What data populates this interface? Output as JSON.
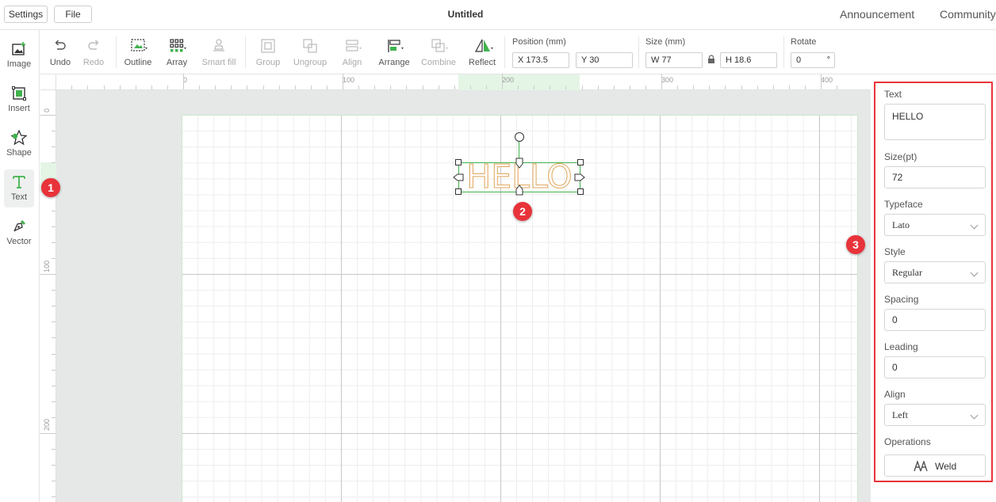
{
  "topbar": {
    "settings_label": "Settings",
    "file_label": "File",
    "title": "Untitled",
    "announcement_label": "Announcement",
    "community_label": "Community"
  },
  "tools": {
    "image": "Image",
    "insert": "Insert",
    "shape": "Shape",
    "text": "Text",
    "vector": "Vector"
  },
  "toolbar": {
    "undo": "Undo",
    "redo": "Redo",
    "outline": "Outline",
    "array": "Array",
    "smart_fill": "Smart fill",
    "group": "Group",
    "ungroup": "Ungroup",
    "align": "Align",
    "arrange": "Arrange",
    "combine": "Combine",
    "reflect": "Reflect",
    "position_label": "Position (mm)",
    "position_x": "X 173.5",
    "position_y": "Y 30",
    "size_label": "Size (mm)",
    "size_w": "W 77",
    "size_h": "H 18.6",
    "rotate_label": "Rotate",
    "rotate_value": "0",
    "rotate_unit": "°"
  },
  "ruler": {
    "top": [
      "0",
      "100",
      "200",
      "300",
      "400"
    ],
    "left": [
      "0",
      "100",
      "200"
    ]
  },
  "canvas": {
    "text_object": "HELLO"
  },
  "badges": [
    "1",
    "2",
    "3"
  ],
  "panel": {
    "text_label": "Text",
    "text_value": "HELLO",
    "size_label": "Size(pt)",
    "size_value": "72",
    "typeface_label": "Typeface",
    "typeface_value": "Lato",
    "style_label": "Style",
    "style_value": "Regular",
    "spacing_label": "Spacing",
    "spacing_value": "0",
    "leading_label": "Leading",
    "leading_value": "0",
    "align_label": "Align",
    "align_value": "Left",
    "operations_label": "Operations",
    "weld_label": "Weld"
  },
  "colors": {
    "accent_green": "#41b24e",
    "callout_red": "#e8333a",
    "text_stroke": "#e0a55a"
  }
}
